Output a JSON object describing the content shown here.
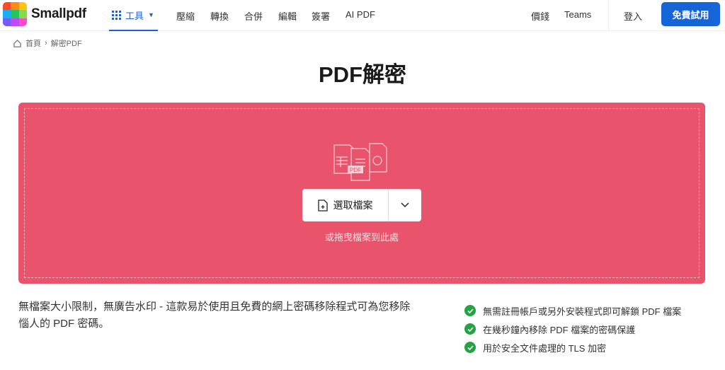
{
  "header": {
    "logo": "Smallpdf",
    "nav": [
      {
        "label": "工具"
      },
      {
        "label": "壓縮"
      },
      {
        "label": "轉換"
      },
      {
        "label": "合併"
      },
      {
        "label": "編輯"
      },
      {
        "label": "簽署"
      },
      {
        "label": "AI PDF"
      }
    ],
    "pricing": "價錢",
    "teams": "Teams",
    "login": "登入",
    "cta": "免費試用"
  },
  "breadcrumb": {
    "home": "首頁",
    "current": "解密PDF"
  },
  "title": "PDF解密",
  "dropzone": {
    "button": "選取檔案",
    "drag_text": "或拖曳檔案到此處",
    "badge": "PDF",
    "color": "#e9536b"
  },
  "description": "無檔案大小限制，無廣告水印 - 這款易於使用且免費的網上密碼移除程式可為您移除惱人的 PDF 密碼。",
  "features": [
    "無需註冊帳戶或另外安裝程式即可解鎖 PDF 檔案",
    "在幾秒鐘內移除 PDF 檔案的密碼保護",
    "用於安全文件處理的 TLS 加密"
  ]
}
